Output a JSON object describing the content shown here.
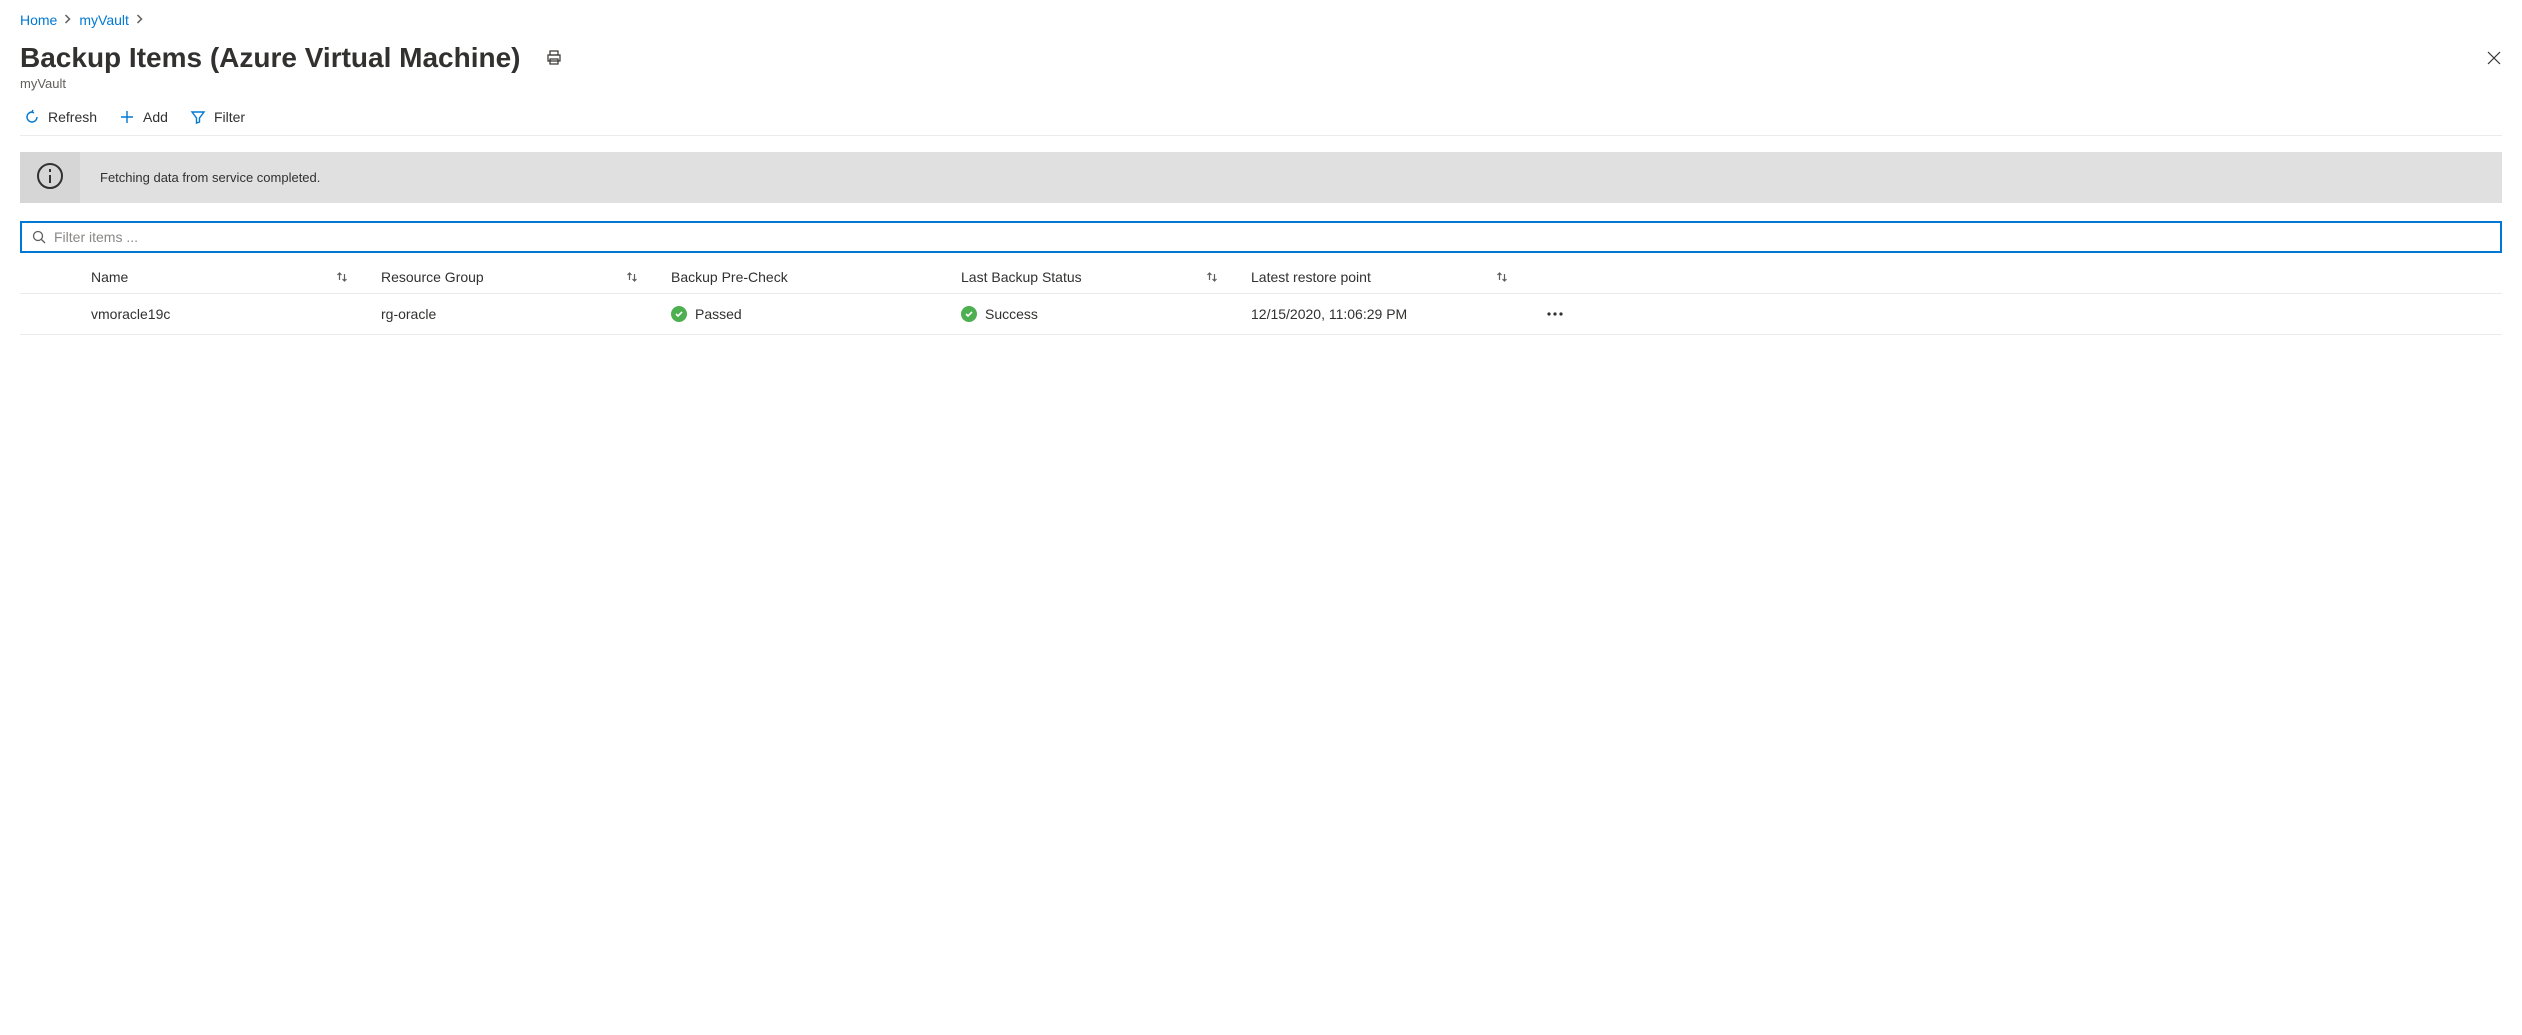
{
  "breadcrumb": {
    "home": "Home",
    "vault": "myVault"
  },
  "page": {
    "title": "Backup Items (Azure Virtual Machine)",
    "subtitle": "myVault"
  },
  "toolbar": {
    "refresh": "Refresh",
    "add": "Add",
    "filter": "Filter"
  },
  "banner": {
    "message": "Fetching data from service completed."
  },
  "filter": {
    "placeholder": "Filter items ..."
  },
  "columns": {
    "name": "Name",
    "resource_group": "Resource Group",
    "precheck": "Backup Pre-Check",
    "status": "Last Backup Status",
    "restore": "Latest restore point"
  },
  "rows": [
    {
      "name": "vmoracle19c",
      "resource_group": "rg-oracle",
      "precheck": "Passed",
      "status": "Success",
      "restore": "12/15/2020, 11:06:29 PM"
    }
  ]
}
